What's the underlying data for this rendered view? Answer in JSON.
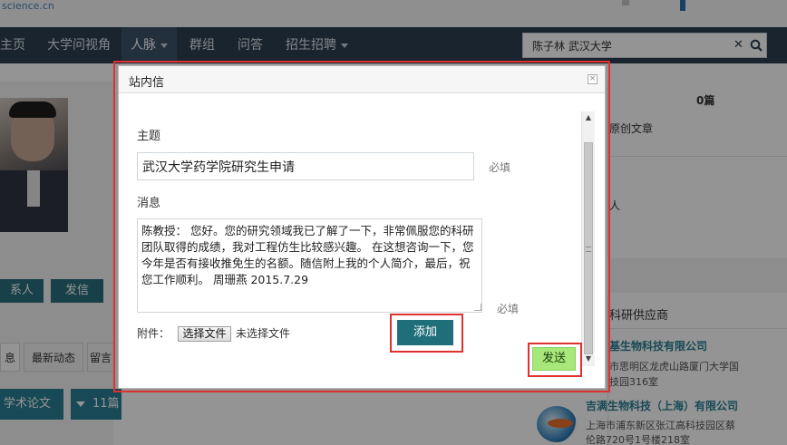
{
  "site": {
    "logo_text": "science.cn",
    "top_right_text": ""
  },
  "nav": {
    "items": [
      "主页",
      "大学问视角",
      "人脉",
      "群组",
      "问答",
      "招生招聘"
    ],
    "active_index": 2,
    "search_value": "陈子林 武汉大学",
    "search_clear": "✕"
  },
  "profile": {
    "contact_button": "系人",
    "message_button": "发信",
    "tabs": [
      "息",
      "最新动态",
      "留言"
    ],
    "papers_button": "学术论文",
    "papers_count": "11篇"
  },
  "right_panel": {
    "count": "0篇",
    "original_articles": "原创文章",
    "partial_item": "人",
    "supplier_heading": "科研供应商",
    "companies": [
      {
        "name": "基生物科技有限公司",
        "address": "市思明区龙虎山路厦门大学国",
        "address2": "技园316室"
      },
      {
        "name": "吉满生物科技（上海）有限公司",
        "address": "上海市浦东新区张江高科技园区蔡",
        "address2": "伦路720号1号楼218室"
      }
    ]
  },
  "dialog": {
    "title": "站内信",
    "close": "×",
    "subject_label": "主题",
    "subject_value": "武汉大学药学院研究生申请",
    "required_label": "必填",
    "message_label": "消息",
    "message_value": "陈教授： 您好。您的研究领域我已了解了一下，非常佩服您的科研团队取得的成绩，我对工程仿生比较感兴趣。 在这想咨询一下，您今年是否有接收推免生的名额。随信附上我的个人简介，最后，祝您工作顺利。 周珊燕 2015.7.29",
    "attachment_label": "附件：",
    "file_button": "选择文件",
    "file_status": "未选择文件",
    "add_button": "添加",
    "send_button": "发送",
    "scroll_up": "▲",
    "scroll_down": "▼"
  },
  "colors": {
    "nav_bg": "#2c3e50",
    "accent": "#1f6f7a",
    "send": "#a8e87a",
    "highlight": "#e03030"
  }
}
